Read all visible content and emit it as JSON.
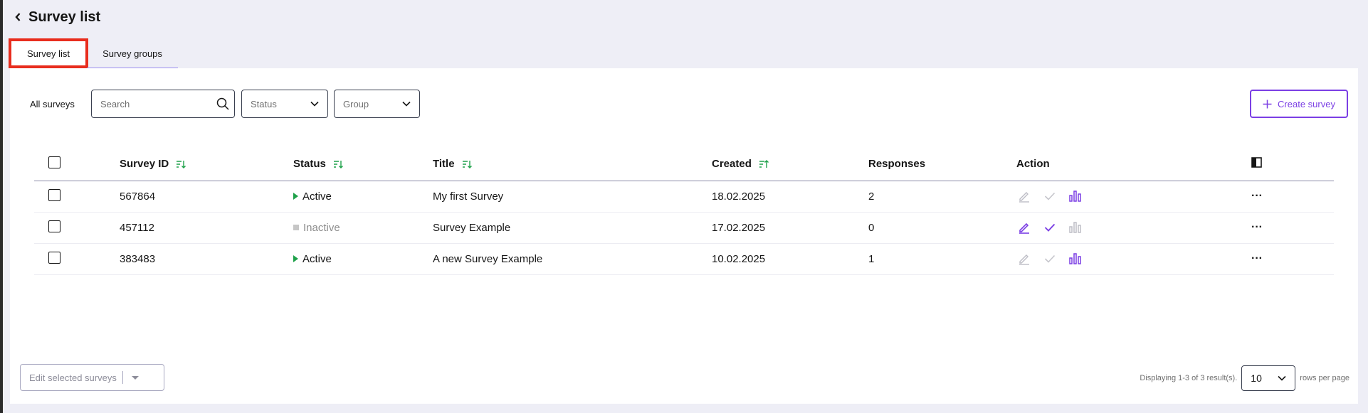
{
  "header": {
    "title": "Survey list",
    "back_icon": "chevron-left-icon"
  },
  "tabs": [
    {
      "label": "Survey list",
      "active": true
    },
    {
      "label": "Survey groups",
      "active": false
    }
  ],
  "toolbar": {
    "all_label": "All surveys",
    "search_placeholder": "Search",
    "status_placeholder": "Status",
    "group_placeholder": "Group",
    "create_label": "Create survey"
  },
  "table": {
    "columns": [
      "Survey ID",
      "Status",
      "Title",
      "Created",
      "Responses",
      "Action"
    ],
    "rows": [
      {
        "id": "567864",
        "status": "Active",
        "title": "My first Survey",
        "created": "18.02.2025",
        "responses": "2"
      },
      {
        "id": "457112",
        "status": "Inactive",
        "title": "Survey Example",
        "created": "17.02.2025",
        "responses": "0"
      },
      {
        "id": "383483",
        "status": "Active",
        "title": "A new Survey Example",
        "created": "10.02.2025",
        "responses": "1"
      }
    ]
  },
  "footer": {
    "bulk_label": "Edit selected surveys",
    "displaying": "Displaying 1-3 of 3 result(s).",
    "rows_value": "10",
    "rows_label": "rows per page"
  },
  "colors": {
    "accent": "#7b3fe4",
    "active": "#1fa14a",
    "highlight": "#e82d1e",
    "background": "#eeeef6"
  }
}
